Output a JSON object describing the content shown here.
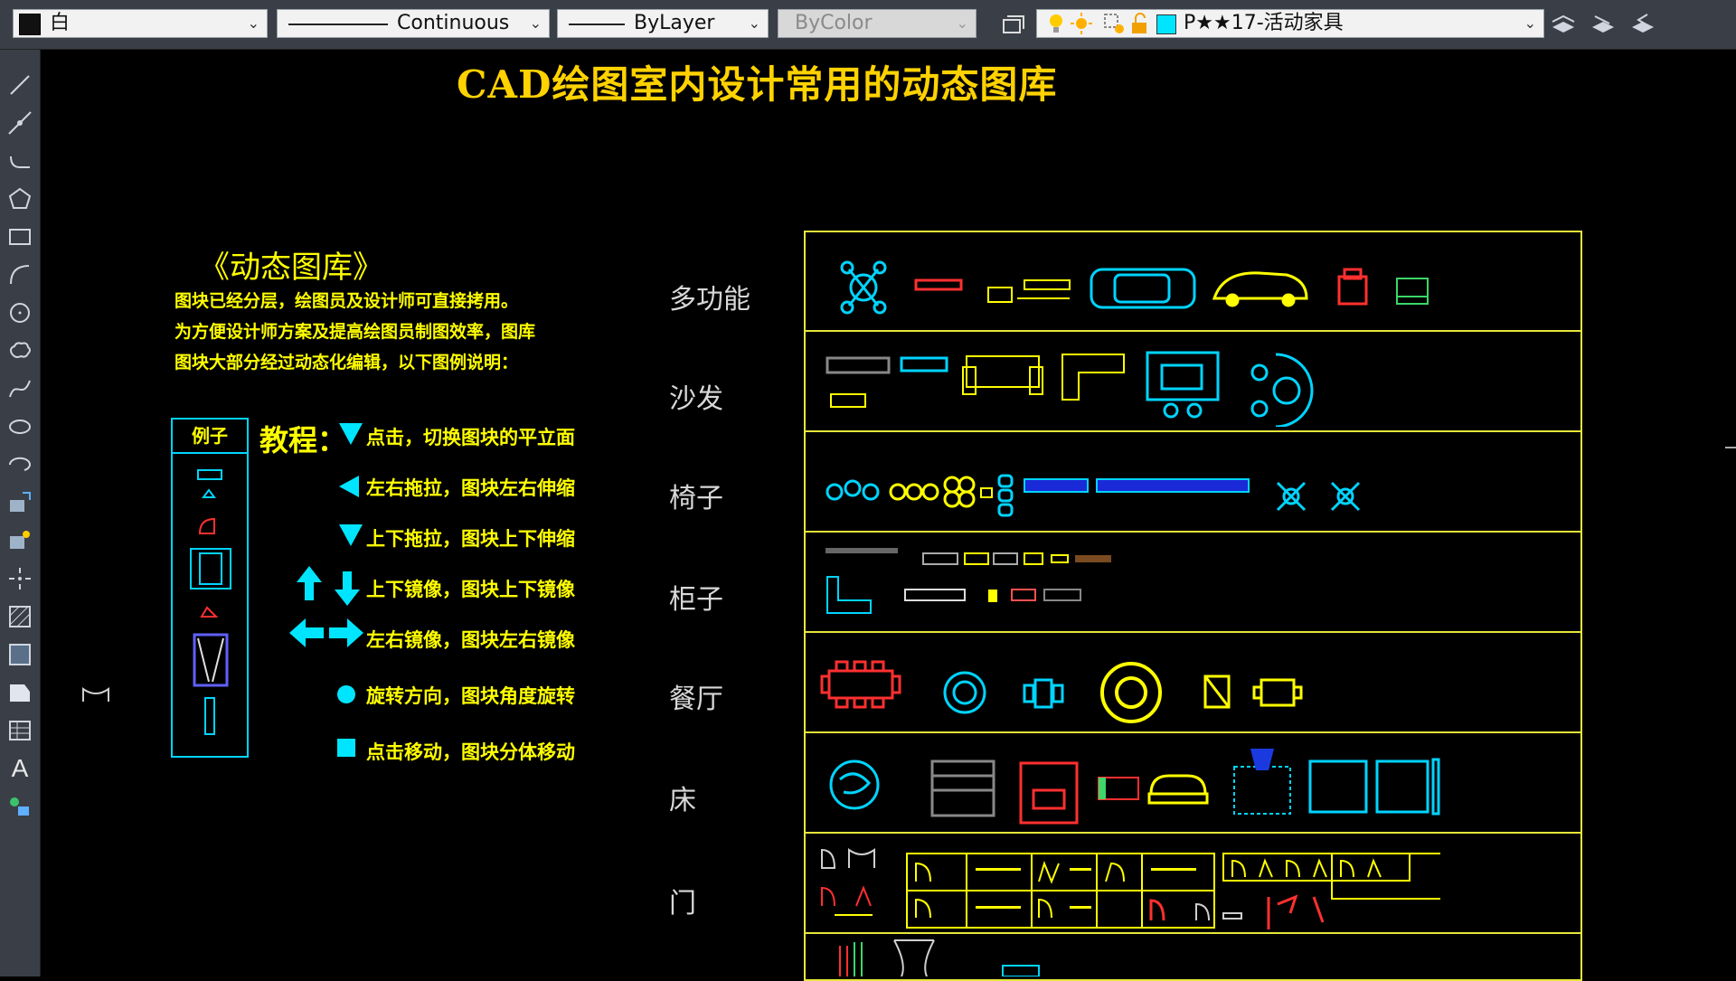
{
  "toolbar": {
    "color_value": "白",
    "linetype_value": "Continuous",
    "lineweight_value": "ByLayer",
    "plotstyle_value": "ByColor",
    "layer_value": "P★★17-活动家具",
    "layer_color": "#00e5ff"
  },
  "canvas": {
    "title": "CAD绘图室内设计常用的动态图库",
    "library_title": "《动态图库》",
    "description": [
      "图块已经分层，绘图员及设计师可直接拷用。",
      "为方便设计师方案及提高绘图员制图效率，图库",
      "图块大部分经过动态化编辑，以下图例说明："
    ],
    "example_label": "例子",
    "tutorial_label": "教程：",
    "tutorial_items": [
      "点击，切换图块的平立面",
      "左右拖拉，图块左右伸缩",
      "上下拖拉，图块上下伸缩",
      "上下镜像，图块上下镜像",
      "左右镜像，图块左右镜像",
      "旋转方向，图块角度旋转",
      "点击移动，图块分体移动"
    ],
    "categories": [
      "多功能",
      "沙发",
      "椅子",
      "柜子",
      "餐厅",
      "床",
      "门"
    ]
  },
  "colors": {
    "title": "#ffd200",
    "text_yellow": "#ffff00",
    "cyan": "#00e5ff",
    "table_border": "#e6e63a"
  }
}
